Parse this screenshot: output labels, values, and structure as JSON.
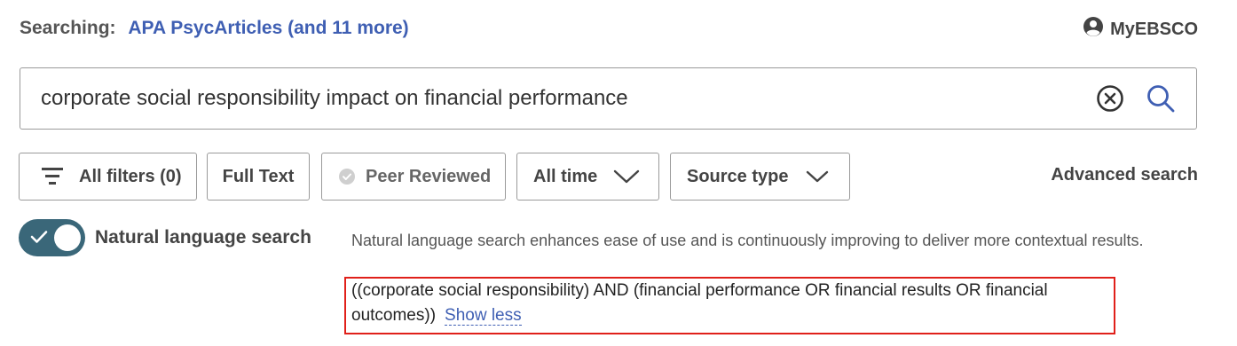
{
  "header": {
    "searching_label": "Searching:",
    "database_link": "APA PsycArticles (and 11 more)",
    "account_label": "MyEBSCO",
    "account_icon": "user-circle-icon"
  },
  "search": {
    "value": "corporate social responsibility impact on financial performance",
    "clear_icon": "clear-circle-icon",
    "search_icon": "search-icon"
  },
  "filters": {
    "all_filters": "All filters (0)",
    "full_text": "Full Text",
    "peer_reviewed": "Peer Reviewed",
    "all_time": "All time",
    "source_type": "Source type",
    "advanced_search": "Advanced search"
  },
  "natural_language": {
    "toggle_on": true,
    "label": "Natural language search",
    "description": "Natural language search enhances ease of use and is continuously improving to deliver more contextual results.",
    "query": "((corporate social responsibility) AND (financial performance OR financial results OR financial outcomes))",
    "show_less": "Show less"
  },
  "colors": {
    "link": "#3f5fb3",
    "toggle": "#3a6779",
    "highlight_border": "#e0201a"
  }
}
